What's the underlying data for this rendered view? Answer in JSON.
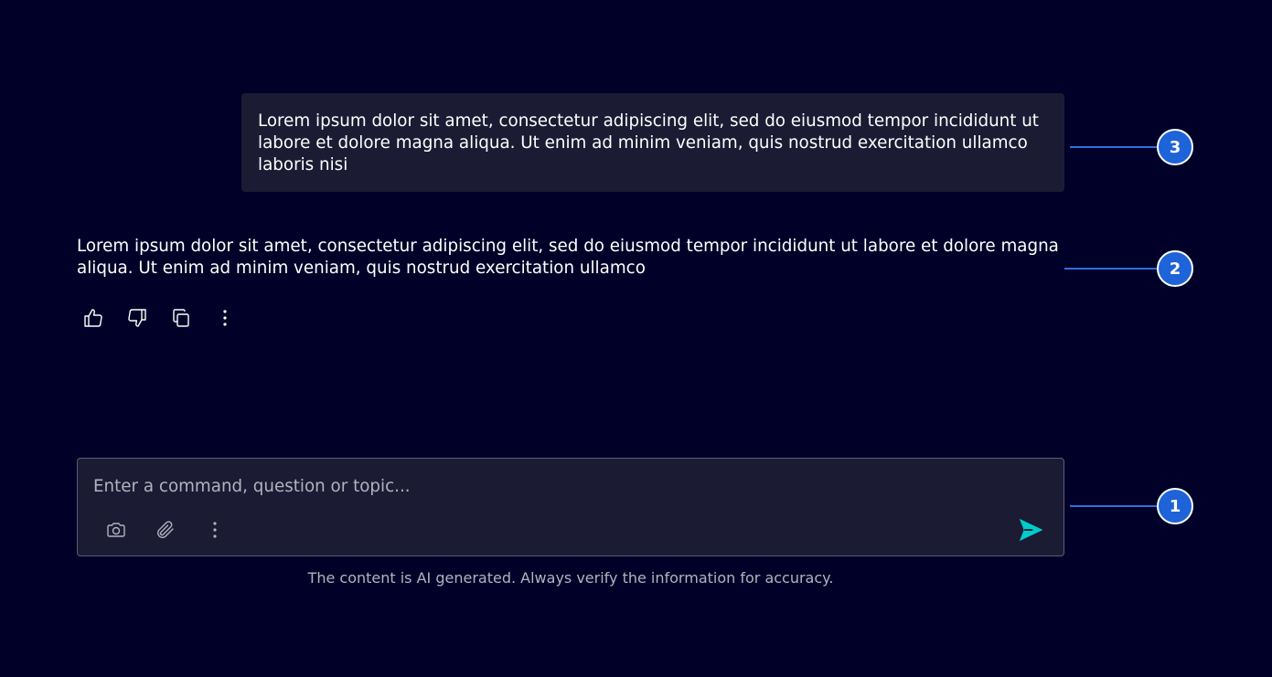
{
  "user_message": {
    "text": "Lorem ipsum dolor sit amet, consectetur adipiscing elit, sed do eiusmod tempor incididunt ut labore et dolore magna aliqua. Ut enim ad minim veniam, quis nostrud exercitation ullamco laboris nisi"
  },
  "ai_message": {
    "text": "Lorem ipsum dolor sit amet, consectetur adipiscing elit, sed do eiusmod tempor incididunt ut labore et dolore magna aliqua. Ut enim ad minim veniam, quis nostrud exercitation ullamco",
    "actions": [
      {
        "name": "thumbs-up-icon"
      },
      {
        "name": "thumbs-down-icon"
      },
      {
        "name": "copy-icon"
      },
      {
        "name": "more-vertical-icon"
      }
    ]
  },
  "composer": {
    "placeholder": "Enter a command, question or topic...",
    "value": "",
    "tools": [
      {
        "name": "camera-icon"
      },
      {
        "name": "paperclip-icon"
      },
      {
        "name": "more-vertical-icon"
      }
    ],
    "send_icon": "send-icon"
  },
  "disclaimer": "The content is AI generated. Always verify the information for accuracy.",
  "callouts": [
    {
      "label": "3"
    },
    {
      "label": "2"
    },
    {
      "label": "1"
    }
  ],
  "colors": {
    "background": "#000028",
    "bubble": "#1b1b33",
    "accent_send": "#00cccc",
    "callout": "#1e63d8"
  }
}
